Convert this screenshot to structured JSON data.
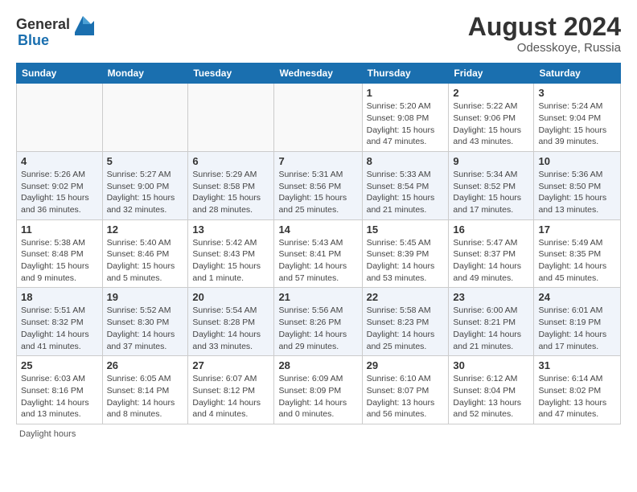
{
  "header": {
    "logo_general": "General",
    "logo_blue": "Blue",
    "month_year": "August 2024",
    "location": "Odesskoye, Russia"
  },
  "weekdays": [
    "Sunday",
    "Monday",
    "Tuesday",
    "Wednesday",
    "Thursday",
    "Friday",
    "Saturday"
  ],
  "weeks": [
    [
      {
        "day": "",
        "info": ""
      },
      {
        "day": "",
        "info": ""
      },
      {
        "day": "",
        "info": ""
      },
      {
        "day": "",
        "info": ""
      },
      {
        "day": "1",
        "info": "Sunrise: 5:20 AM\nSunset: 9:08 PM\nDaylight: 15 hours and 47 minutes."
      },
      {
        "day": "2",
        "info": "Sunrise: 5:22 AM\nSunset: 9:06 PM\nDaylight: 15 hours and 43 minutes."
      },
      {
        "day": "3",
        "info": "Sunrise: 5:24 AM\nSunset: 9:04 PM\nDaylight: 15 hours and 39 minutes."
      }
    ],
    [
      {
        "day": "4",
        "info": "Sunrise: 5:26 AM\nSunset: 9:02 PM\nDaylight: 15 hours and 36 minutes."
      },
      {
        "day": "5",
        "info": "Sunrise: 5:27 AM\nSunset: 9:00 PM\nDaylight: 15 hours and 32 minutes."
      },
      {
        "day": "6",
        "info": "Sunrise: 5:29 AM\nSunset: 8:58 PM\nDaylight: 15 hours and 28 minutes."
      },
      {
        "day": "7",
        "info": "Sunrise: 5:31 AM\nSunset: 8:56 PM\nDaylight: 15 hours and 25 minutes."
      },
      {
        "day": "8",
        "info": "Sunrise: 5:33 AM\nSunset: 8:54 PM\nDaylight: 15 hours and 21 minutes."
      },
      {
        "day": "9",
        "info": "Sunrise: 5:34 AM\nSunset: 8:52 PM\nDaylight: 15 hours and 17 minutes."
      },
      {
        "day": "10",
        "info": "Sunrise: 5:36 AM\nSunset: 8:50 PM\nDaylight: 15 hours and 13 minutes."
      }
    ],
    [
      {
        "day": "11",
        "info": "Sunrise: 5:38 AM\nSunset: 8:48 PM\nDaylight: 15 hours and 9 minutes."
      },
      {
        "day": "12",
        "info": "Sunrise: 5:40 AM\nSunset: 8:46 PM\nDaylight: 15 hours and 5 minutes."
      },
      {
        "day": "13",
        "info": "Sunrise: 5:42 AM\nSunset: 8:43 PM\nDaylight: 15 hours and 1 minute."
      },
      {
        "day": "14",
        "info": "Sunrise: 5:43 AM\nSunset: 8:41 PM\nDaylight: 14 hours and 57 minutes."
      },
      {
        "day": "15",
        "info": "Sunrise: 5:45 AM\nSunset: 8:39 PM\nDaylight: 14 hours and 53 minutes."
      },
      {
        "day": "16",
        "info": "Sunrise: 5:47 AM\nSunset: 8:37 PM\nDaylight: 14 hours and 49 minutes."
      },
      {
        "day": "17",
        "info": "Sunrise: 5:49 AM\nSunset: 8:35 PM\nDaylight: 14 hours and 45 minutes."
      }
    ],
    [
      {
        "day": "18",
        "info": "Sunrise: 5:51 AM\nSunset: 8:32 PM\nDaylight: 14 hours and 41 minutes."
      },
      {
        "day": "19",
        "info": "Sunrise: 5:52 AM\nSunset: 8:30 PM\nDaylight: 14 hours and 37 minutes."
      },
      {
        "day": "20",
        "info": "Sunrise: 5:54 AM\nSunset: 8:28 PM\nDaylight: 14 hours and 33 minutes."
      },
      {
        "day": "21",
        "info": "Sunrise: 5:56 AM\nSunset: 8:26 PM\nDaylight: 14 hours and 29 minutes."
      },
      {
        "day": "22",
        "info": "Sunrise: 5:58 AM\nSunset: 8:23 PM\nDaylight: 14 hours and 25 minutes."
      },
      {
        "day": "23",
        "info": "Sunrise: 6:00 AM\nSunset: 8:21 PM\nDaylight: 14 hours and 21 minutes."
      },
      {
        "day": "24",
        "info": "Sunrise: 6:01 AM\nSunset: 8:19 PM\nDaylight: 14 hours and 17 minutes."
      }
    ],
    [
      {
        "day": "25",
        "info": "Sunrise: 6:03 AM\nSunset: 8:16 PM\nDaylight: 14 hours and 13 minutes."
      },
      {
        "day": "26",
        "info": "Sunrise: 6:05 AM\nSunset: 8:14 PM\nDaylight: 14 hours and 8 minutes."
      },
      {
        "day": "27",
        "info": "Sunrise: 6:07 AM\nSunset: 8:12 PM\nDaylight: 14 hours and 4 minutes."
      },
      {
        "day": "28",
        "info": "Sunrise: 6:09 AM\nSunset: 8:09 PM\nDaylight: 14 hours and 0 minutes."
      },
      {
        "day": "29",
        "info": "Sunrise: 6:10 AM\nSunset: 8:07 PM\nDaylight: 13 hours and 56 minutes."
      },
      {
        "day": "30",
        "info": "Sunrise: 6:12 AM\nSunset: 8:04 PM\nDaylight: 13 hours and 52 minutes."
      },
      {
        "day": "31",
        "info": "Sunrise: 6:14 AM\nSunset: 8:02 PM\nDaylight: 13 hours and 47 minutes."
      }
    ]
  ],
  "footer": {
    "daylight_label": "Daylight hours"
  }
}
